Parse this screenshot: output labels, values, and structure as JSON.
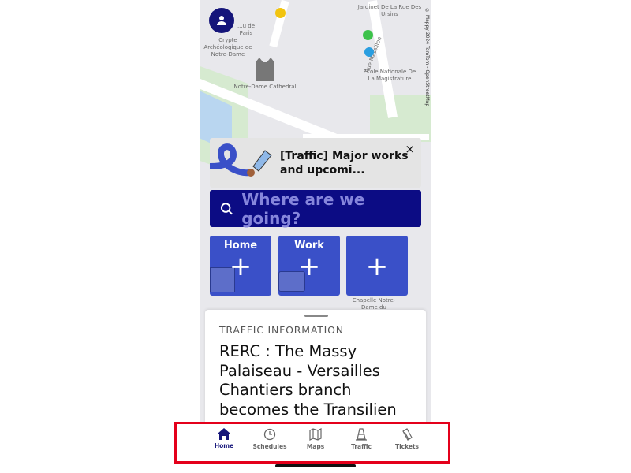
{
  "map": {
    "labels": [
      "Jardinet De La Rue Des Ursins",
      "Crypte Archéologique de Notre-Dame",
      "Notre-Dame Cathedral",
      "Ecole Nationale De La Magistrature",
      "Rue Massillon",
      "Chapelle Notre-Dame du Chardonnet",
      "...u de Paris"
    ],
    "attribution": "© Mappy 2024 TomTom - OpenStreetMap"
  },
  "banner": {
    "text": "[Traffic] Major works and upcomi...",
    "close_label": "×"
  },
  "search": {
    "placeholder": "Where are we going?"
  },
  "shortcuts": [
    {
      "label": "Home",
      "plus": "+"
    },
    {
      "label": "Work",
      "plus": "+"
    },
    {
      "label": "",
      "plus": "+"
    }
  ],
  "traffic_card": {
    "heading": "TRAFFIC INFORMATION",
    "body": "RERC : The Massy Palaiseau - Versailles Chantiers branch becomes the Transilien"
  },
  "nav": {
    "items": [
      {
        "label": "Home",
        "icon": "home-icon",
        "active": true
      },
      {
        "label": "Schedules",
        "icon": "clock-icon"
      },
      {
        "label": "Maps",
        "icon": "map-icon"
      },
      {
        "label": "Traffic",
        "icon": "traffic-cone-icon"
      },
      {
        "label": "Tickets",
        "icon": "ticket-icon"
      }
    ]
  },
  "colors": {
    "navy": "#15157a",
    "search_bg": "#0c0c84",
    "tile": "#3a50c8",
    "highlight": "#e4001b"
  }
}
